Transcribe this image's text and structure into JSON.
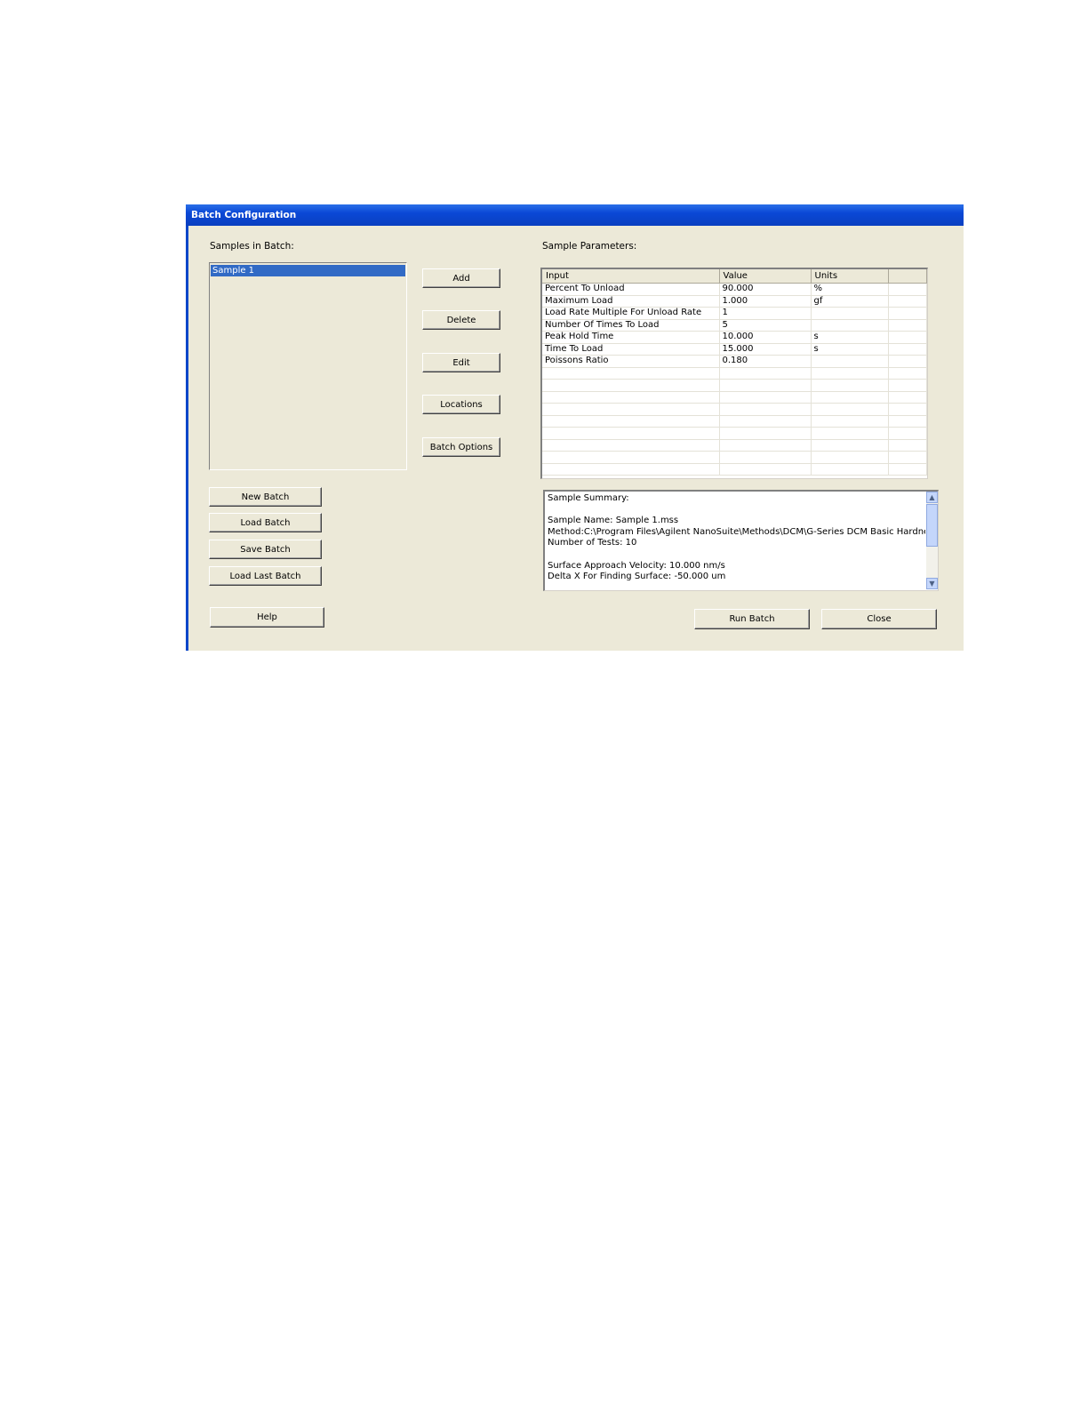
{
  "window": {
    "title": "Batch Configuration"
  },
  "samples": {
    "label": "Samples in Batch:",
    "items": [
      "Sample 1"
    ]
  },
  "actions": {
    "add": "Add",
    "delete": "Delete",
    "edit": "Edit",
    "locations": "Locations",
    "batch_options": "Batch Options"
  },
  "batch": {
    "new": "New Batch",
    "load": "Load Batch",
    "save": "Save Batch",
    "load_last": "Load Last Batch"
  },
  "parameters": {
    "label": "Sample Parameters:",
    "columns": [
      "Input",
      "Value",
      "Units",
      ""
    ],
    "rows": [
      {
        "input": "Percent To Unload",
        "value": "90.000",
        "units": "%"
      },
      {
        "input": "Maximum Load",
        "value": "1.000",
        "units": "gf"
      },
      {
        "input": "Load Rate Multiple For Unload Rate",
        "value": "1",
        "units": ""
      },
      {
        "input": "Number Of Times To Load",
        "value": "5",
        "units": ""
      },
      {
        "input": "Peak Hold Time",
        "value": "10.000",
        "units": "s"
      },
      {
        "input": "Time To Load",
        "value": "15.000",
        "units": "s"
      },
      {
        "input": "Poissons Ratio",
        "value": "0.180",
        "units": ""
      },
      {
        "input": "",
        "value": "",
        "units": ""
      },
      {
        "input": "",
        "value": "",
        "units": ""
      },
      {
        "input": "",
        "value": "",
        "units": ""
      },
      {
        "input": "",
        "value": "",
        "units": ""
      },
      {
        "input": "",
        "value": "",
        "units": ""
      },
      {
        "input": "",
        "value": "",
        "units": ""
      },
      {
        "input": "",
        "value": "",
        "units": ""
      },
      {
        "input": "",
        "value": "",
        "units": ""
      },
      {
        "input": "",
        "value": "",
        "units": ""
      }
    ]
  },
  "summary": {
    "lines": [
      "Sample Summary:",
      "",
      "Sample Name: Sample 1.mss",
      "Method:C:\\Program Files\\Agilent NanoSuite\\Methods\\DCM\\G-Series DCM Basic Hardness, Modulus, Tip Cal, Load Control.msm",
      "Number of Tests: 10",
      "",
      "Surface Approach Velocity: 10.000 nm/s",
      "Delta X For Finding Surface: -50.000 um"
    ]
  },
  "footer": {
    "help": "Help",
    "run_batch": "Run Batch",
    "close": "Close"
  }
}
